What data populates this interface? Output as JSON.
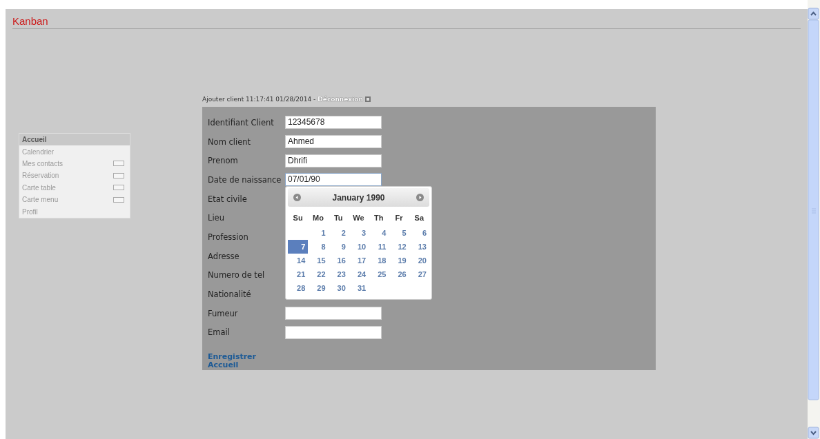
{
  "header": {
    "title": "Kanban"
  },
  "sidebar": {
    "items": [
      {
        "label": "Accueil",
        "selected": true,
        "kind": "plain"
      },
      {
        "label": "Calendrier",
        "selected": false,
        "kind": "plain"
      },
      {
        "label": "Mes contacts",
        "selected": false,
        "kind": "boxed"
      },
      {
        "label": "Réservation",
        "selected": false,
        "kind": "boxed"
      },
      {
        "label": "Carte table",
        "selected": false,
        "kind": "boxed"
      },
      {
        "label": "Carte menu",
        "selected": false,
        "kind": "boxed"
      },
      {
        "label": "Profil",
        "selected": false,
        "kind": "plain"
      }
    ]
  },
  "topline": {
    "text": "Ajouter client 11:17:41 01/28/2014 -",
    "logout": "Déconnexion"
  },
  "form": {
    "fields": [
      {
        "label": "Identifiant Client",
        "kind": "input",
        "value": "12345678",
        "focused": false
      },
      {
        "label": "Nom client",
        "kind": "input",
        "value": "Ahmed",
        "focused": false
      },
      {
        "label": "Prenom",
        "kind": "input",
        "value": "Dhrifi",
        "focused": false
      },
      {
        "label": "Date de naissance",
        "kind": "input",
        "value": "07/01/90",
        "focused": true
      },
      {
        "label": "Etat civile",
        "kind": "covered"
      },
      {
        "label": "Lieu",
        "kind": "covered"
      },
      {
        "label": "Profession",
        "kind": "covered"
      },
      {
        "label": "Adresse",
        "kind": "covered"
      },
      {
        "label": "Numero de tel",
        "kind": "covered"
      },
      {
        "label": "Nationalité",
        "kind": "covered"
      },
      {
        "label": "Fumeur",
        "kind": "input",
        "focused": false
      },
      {
        "label": "Email",
        "kind": "input",
        "focused": false
      }
    ],
    "links": [
      "Enregistrer",
      "Accueil"
    ]
  },
  "datepicker": {
    "month": "January 1990",
    "weekdays": [
      "Su",
      "Mo",
      "Tu",
      "We",
      "Th",
      "Fr",
      "Sa"
    ],
    "weeks": [
      [
        {
          "kind": "empty"
        },
        {
          "kind": "day",
          "day": "1",
          "selected": false
        },
        {
          "kind": "day",
          "day": "2",
          "selected": false
        },
        {
          "kind": "day",
          "day": "3",
          "selected": false
        },
        {
          "kind": "day",
          "day": "4",
          "selected": false
        },
        {
          "kind": "day",
          "day": "5",
          "selected": false
        },
        {
          "kind": "day",
          "day": "6",
          "selected": false
        }
      ],
      [
        {
          "kind": "day",
          "day": "7",
          "selected": true
        },
        {
          "kind": "day",
          "day": "8",
          "selected": false
        },
        {
          "kind": "day",
          "day": "9",
          "selected": false
        },
        {
          "kind": "day",
          "day": "10",
          "selected": false
        },
        {
          "kind": "day",
          "day": "11",
          "selected": false
        },
        {
          "kind": "day",
          "day": "12",
          "selected": false
        },
        {
          "kind": "day",
          "day": "13",
          "selected": false
        }
      ],
      [
        {
          "kind": "day",
          "day": "14",
          "selected": false
        },
        {
          "kind": "day",
          "day": "15",
          "selected": false
        },
        {
          "kind": "day",
          "day": "16",
          "selected": false
        },
        {
          "kind": "day",
          "day": "17",
          "selected": false
        },
        {
          "kind": "day",
          "day": "18",
          "selected": false
        },
        {
          "kind": "day",
          "day": "19",
          "selected": false
        },
        {
          "kind": "day",
          "day": "20",
          "selected": false
        }
      ],
      [
        {
          "kind": "day",
          "day": "21",
          "selected": false
        },
        {
          "kind": "day",
          "day": "22",
          "selected": false
        },
        {
          "kind": "day",
          "day": "23",
          "selected": false
        },
        {
          "kind": "day",
          "day": "24",
          "selected": false
        },
        {
          "kind": "day",
          "day": "25",
          "selected": false
        },
        {
          "kind": "day",
          "day": "26",
          "selected": false
        },
        {
          "kind": "day",
          "day": "27",
          "selected": false
        }
      ],
      [
        {
          "kind": "day",
          "day": "28",
          "selected": false
        },
        {
          "kind": "day",
          "day": "29",
          "selected": false
        },
        {
          "kind": "day",
          "day": "30",
          "selected": false
        },
        {
          "kind": "day",
          "day": "31",
          "selected": false
        },
        {
          "kind": "empty"
        },
        {
          "kind": "empty"
        },
        {
          "kind": "empty"
        }
      ]
    ]
  }
}
